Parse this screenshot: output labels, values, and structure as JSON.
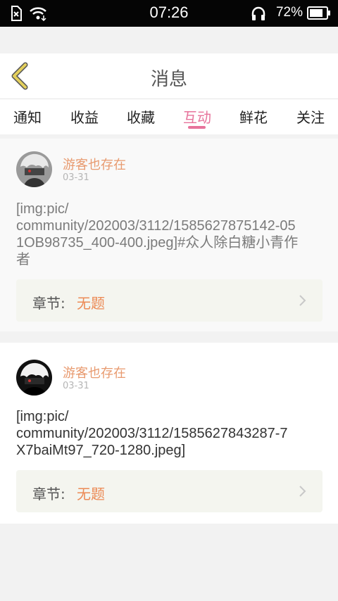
{
  "status_bar": {
    "time": "07:26",
    "battery_percent": "72%",
    "icons": [
      "no-sim-icon",
      "wifi-icon",
      "headphones-icon",
      "battery-icon"
    ]
  },
  "header": {
    "title": "消息",
    "back_icon": "chevron-left-icon"
  },
  "tabs": [
    {
      "label": "通知",
      "active": false
    },
    {
      "label": "收益",
      "active": false
    },
    {
      "label": "收藏",
      "active": false
    },
    {
      "label": "互动",
      "active": true
    },
    {
      "label": "鲜花",
      "active": false
    },
    {
      "label": "关注",
      "active": false
    }
  ],
  "messages": [
    {
      "username": "游客也存在",
      "date": "03-31",
      "content_lines": [
        "[img:pic/",
        "community/202003/3112/1585627875142-05",
        "1OB98735_400-400.jpeg]#众人除白糖小青作",
        "者"
      ],
      "chapter_label": "章节:",
      "chapter_value": "无题"
    },
    {
      "username": "游客也存在",
      "date": "03-31",
      "content_lines": [
        "[img:pic/",
        "community/202003/3112/1585627843287-7",
        "X7baiMt97_720-1280.jpeg]"
      ],
      "chapter_label": "章节:",
      "chapter_value": "无题"
    }
  ],
  "colors": {
    "accent": "#e7739b",
    "username": "#e89a6f",
    "chapter_value": "#ec8a55",
    "back_icon": "#d8c14a"
  }
}
